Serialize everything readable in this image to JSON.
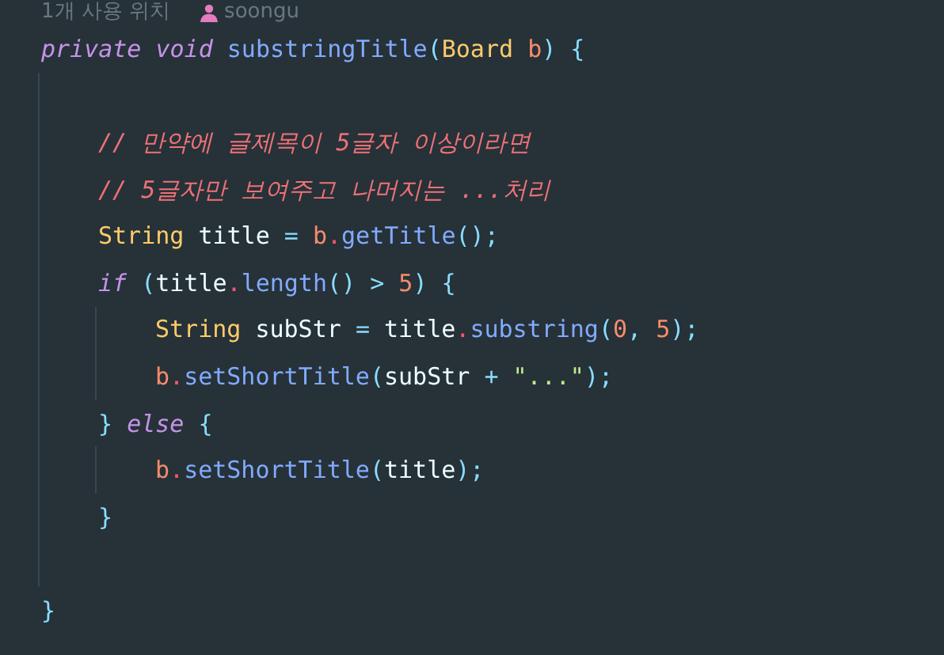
{
  "usage_hint": {
    "usages": "1개 사용 위치",
    "author": "soongu"
  },
  "code": [
    {
      "tokens": [
        {
          "text": "private void ",
          "kind": "keyword"
        },
        {
          "text": "substringTitle",
          "kind": "method"
        },
        {
          "text": "(",
          "kind": "punct"
        },
        {
          "text": "Board ",
          "kind": "type"
        },
        {
          "text": "b",
          "kind": "param"
        },
        {
          "text": ") {",
          "kind": "punct"
        }
      ],
      "children": [
        {
          "kind": "blank"
        },
        {
          "tokens": [
            {
              "text": "// 만약에 글제목이 5글자 이상이라면",
              "kind": "comment"
            }
          ]
        },
        {
          "tokens": [
            {
              "text": "// 5글자만 보여주고 나머지는 ...처리",
              "kind": "comment"
            }
          ]
        },
        {
          "tokens": [
            {
              "text": "String ",
              "kind": "type"
            },
            {
              "text": "title ",
              "kind": "var"
            },
            {
              "text": "= ",
              "kind": "punct"
            },
            {
              "text": "b",
              "kind": "param"
            },
            {
              "text": ".",
              "kind": "dot"
            },
            {
              "text": "getTitle",
              "kind": "method"
            },
            {
              "text": "();",
              "kind": "punct"
            }
          ]
        },
        {
          "tokens": [
            {
              "text": "if ",
              "kind": "keyword"
            },
            {
              "text": "(",
              "kind": "punct"
            },
            {
              "text": "title",
              "kind": "var"
            },
            {
              "text": ".",
              "kind": "dot"
            },
            {
              "text": "length",
              "kind": "method"
            },
            {
              "text": "() > ",
              "kind": "punct"
            },
            {
              "text": "5",
              "kind": "number"
            },
            {
              "text": ") {",
              "kind": "punct"
            }
          ],
          "children": [
            {
              "tokens": [
                {
                  "text": "String ",
                  "kind": "type"
                },
                {
                  "text": "subStr ",
                  "kind": "var"
                },
                {
                  "text": "= ",
                  "kind": "punct"
                },
                {
                  "text": "title",
                  "kind": "var"
                },
                {
                  "text": ".",
                  "kind": "dot"
                },
                {
                  "text": "substring",
                  "kind": "method"
                },
                {
                  "text": "(",
                  "kind": "punct"
                },
                {
                  "text": "0",
                  "kind": "number"
                },
                {
                  "text": ", ",
                  "kind": "punct"
                },
                {
                  "text": "5",
                  "kind": "number"
                },
                {
                  "text": ");",
                  "kind": "punct"
                }
              ]
            },
            {
              "tokens": [
                {
                  "text": "b",
                  "kind": "param"
                },
                {
                  "text": ".",
                  "kind": "dot"
                },
                {
                  "text": "setShortTitle",
                  "kind": "method"
                },
                {
                  "text": "(",
                  "kind": "punct"
                },
                {
                  "text": "subStr ",
                  "kind": "var"
                },
                {
                  "text": "+ ",
                  "kind": "punct"
                },
                {
                  "text": "\"...\"",
                  "kind": "string"
                },
                {
                  "text": ");",
                  "kind": "punct"
                }
              ]
            }
          ]
        },
        {
          "tokens": [
            {
              "text": "} ",
              "kind": "punct"
            },
            {
              "text": "else ",
              "kind": "keyword"
            },
            {
              "text": "{",
              "kind": "punct"
            }
          ],
          "children": [
            {
              "tokens": [
                {
                  "text": "b",
                  "kind": "param"
                },
                {
                  "text": ".",
                  "kind": "dot"
                },
                {
                  "text": "setShortTitle",
                  "kind": "method"
                },
                {
                  "text": "(",
                  "kind": "punct"
                },
                {
                  "text": "title",
                  "kind": "var"
                },
                {
                  "text": ");",
                  "kind": "punct"
                }
              ]
            }
          ]
        },
        {
          "tokens": [
            {
              "text": "}",
              "kind": "punct"
            }
          ]
        },
        {
          "kind": "blank"
        }
      ]
    },
    {
      "tokens": [
        {
          "text": "}",
          "kind": "punct"
        }
      ]
    }
  ]
}
